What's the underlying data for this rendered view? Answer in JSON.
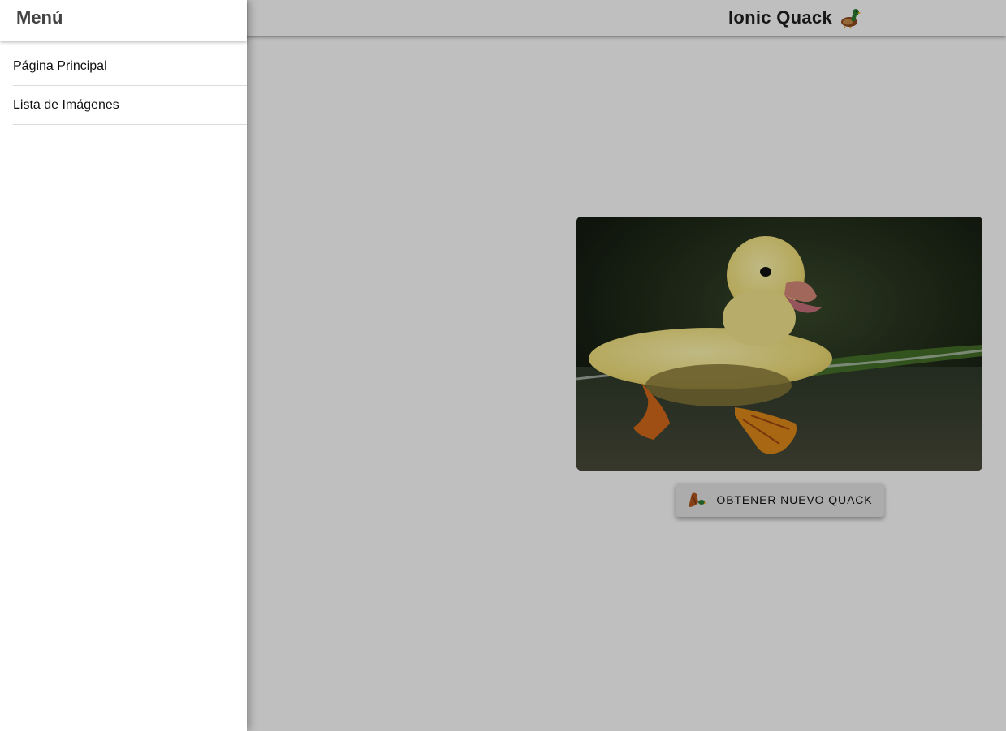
{
  "header": {
    "title": "Ionic Quack",
    "title_icon": "duck-icon"
  },
  "menu": {
    "title": "Menú",
    "items": [
      {
        "label": "Página Principal"
      },
      {
        "label": "Lista de Imágenes"
      }
    ]
  },
  "main": {
    "image_subject": "duckling swimming",
    "button_label": "OBTENER NUEVO QUACK",
    "button_icon": "duck-icon"
  },
  "colors": {
    "backdrop": "#bfbfbf",
    "menu_background": "#ffffff",
    "menu_title": "#444444"
  }
}
